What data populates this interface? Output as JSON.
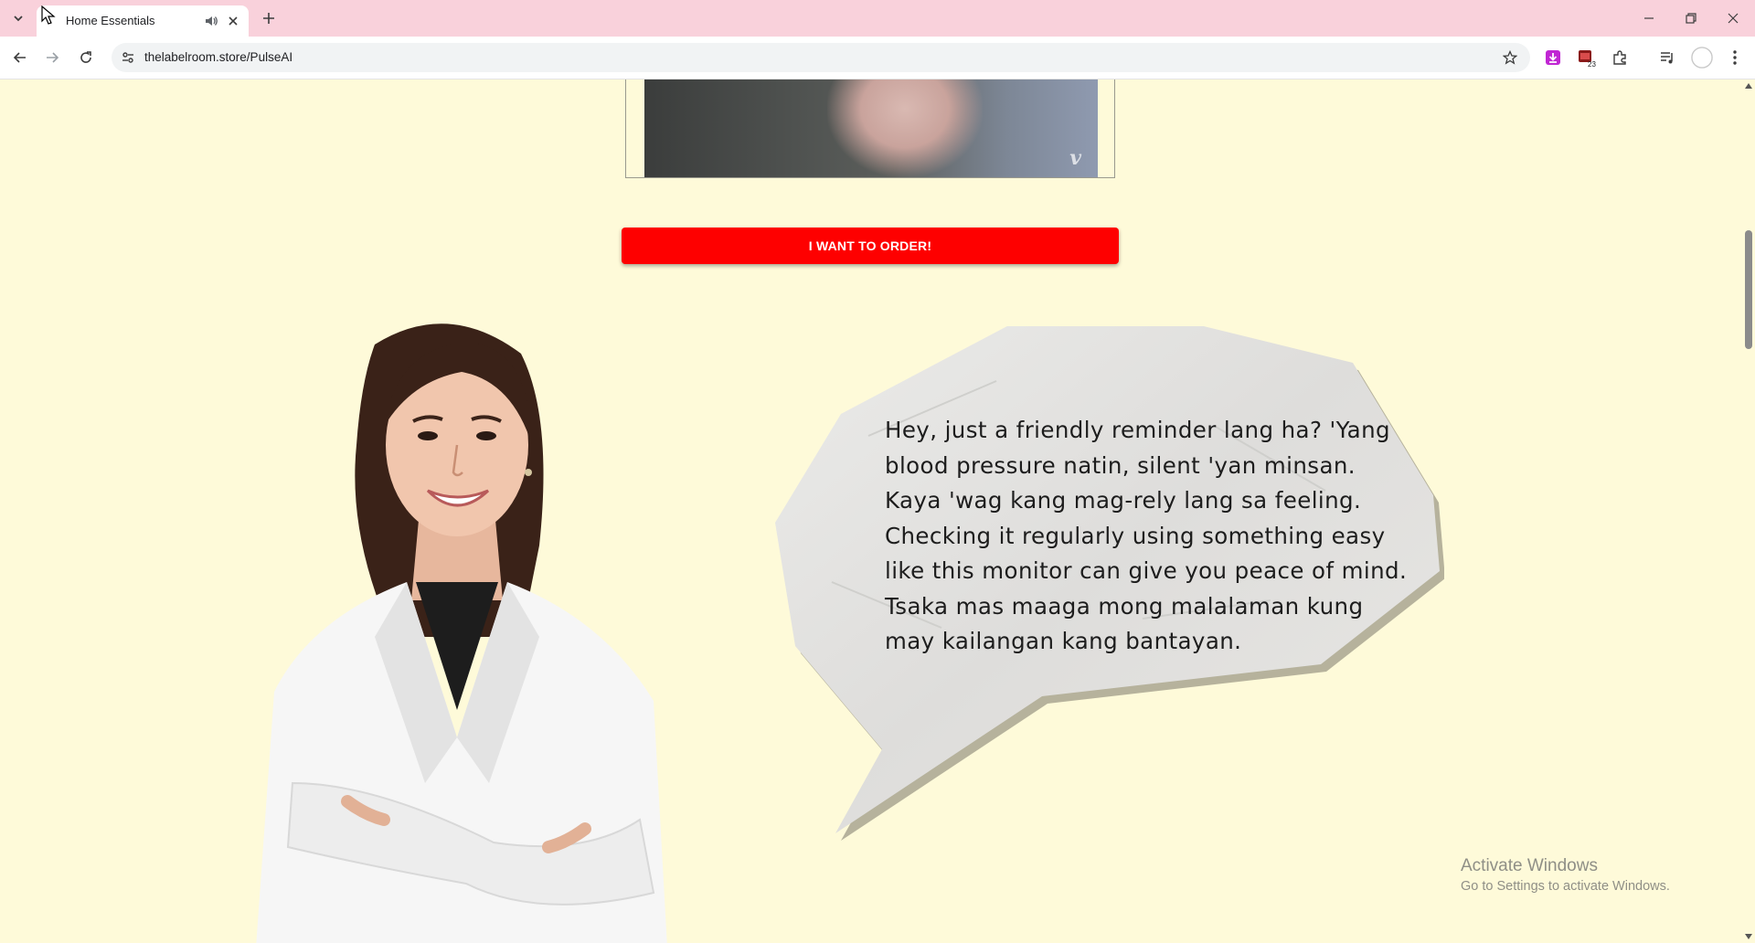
{
  "browser": {
    "tab_title": "Home Essentials",
    "url": "thelabelroom.store/PulseAI",
    "extension_badge": "23"
  },
  "page": {
    "order_button_label": "I WANT TO ORDER!",
    "speech_bubble_text": "Hey, just a friendly reminder lang ha? 'Yang blood pressure natin, silent 'yan minsan. Kaya 'wag kang mag-rely lang sa feeling. Checking it regularly using something easy like this monitor can give you peace of mind. Tsaka mas maaga mong malalaman kung may kailangan kang bantayan.",
    "video_logo": "v"
  },
  "windows_watermark": {
    "title": "Activate Windows",
    "subtitle": "Go to Settings to activate Windows."
  },
  "colors": {
    "page_background": "#fefad9",
    "tabbar_background": "#f9d1db",
    "order_button": "#fe0000"
  }
}
